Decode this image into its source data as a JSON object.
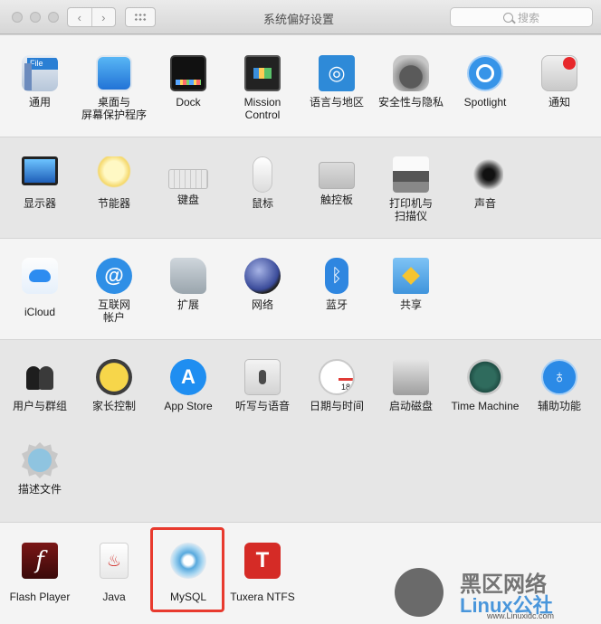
{
  "window": {
    "title": "系统偏好设置"
  },
  "toolbar": {
    "back": "‹",
    "forward": "›",
    "search_placeholder": "搜索"
  },
  "sections": [
    {
      "items": [
        {
          "label": "通用"
        },
        {
          "label": "桌面与\n屏幕保护程序"
        },
        {
          "label": "Dock"
        },
        {
          "label": "Mission\nControl"
        },
        {
          "label": "语言与地区"
        },
        {
          "label": "安全性与隐私"
        },
        {
          "label": "Spotlight"
        },
        {
          "label": "通知"
        }
      ]
    },
    {
      "items": [
        {
          "label": "显示器"
        },
        {
          "label": "节能器"
        },
        {
          "label": "键盘"
        },
        {
          "label": "鼠标"
        },
        {
          "label": "触控板"
        },
        {
          "label": "打印机与\n扫描仪"
        },
        {
          "label": "声音"
        }
      ]
    },
    {
      "items": [
        {
          "label": "iCloud"
        },
        {
          "label": "互联网\n帐户"
        },
        {
          "label": "扩展"
        },
        {
          "label": "网络"
        },
        {
          "label": "蓝牙"
        },
        {
          "label": "共享"
        }
      ]
    },
    {
      "items": [
        {
          "label": "用户与群组"
        },
        {
          "label": "家长控制"
        },
        {
          "label": "App Store"
        },
        {
          "label": "听写与语音"
        },
        {
          "label": "日期与时间"
        },
        {
          "label": "启动磁盘"
        },
        {
          "label": "Time Machine"
        },
        {
          "label": "辅助功能"
        },
        {
          "label": "描述文件"
        }
      ]
    },
    {
      "items": [
        {
          "label": "Flash Player"
        },
        {
          "label": "Java"
        },
        {
          "label": "MySQL"
        },
        {
          "label": "Tuxera NTFS"
        }
      ]
    }
  ],
  "watermark": {
    "text1": "黑区网络",
    "text2": "Linux公社",
    "url": "www.Linuxidc.com"
  },
  "colors": {
    "highlight": "#e83a2e",
    "accent": "#2e86e0"
  }
}
